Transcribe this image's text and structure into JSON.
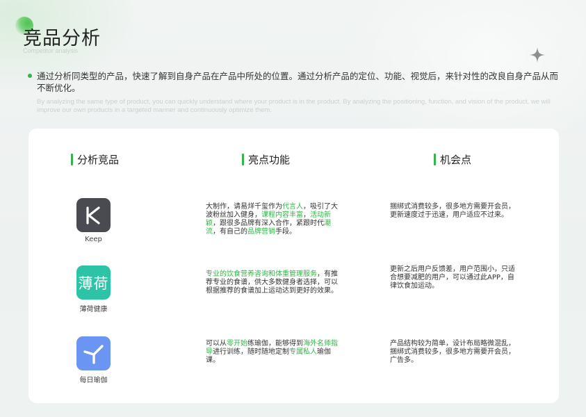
{
  "page": {
    "title": "竞品分析",
    "subtitle": "Competitor analysis"
  },
  "intro": {
    "cn": "通过分析同类型的产品，快速了解到自身产品在产品中所处的位置。通过分析产品的定位、功能、视觉后，来针对性的改良自身产品从而不断优化。",
    "en": "By analyzing the same type of product, you can quickly understand where your product is in the product. By analyzing the positioning, function, and vision of the product, we will improve our own products in a targeted manner and continuously optimize them."
  },
  "columns": [
    "分析竞品",
    "亮点功能",
    "机会点"
  ],
  "colors": {
    "accent": "#34b44a",
    "keep_icon": "#4a4a52",
    "boohee_icon": "#2dc3a6",
    "yoga_icon": "#6b95f3"
  },
  "rows": [
    {
      "app": {
        "name": "Keep",
        "icon": "keep-logo-icon"
      },
      "highlight": [
        {
          "t": "大制作，请易烊千玺作为"
        },
        {
          "t": "代言人",
          "hl": true
        },
        {
          "t": "，吸引了大波粉丝加入健身，"
        },
        {
          "t": "课程内容丰富",
          "hl": true
        },
        {
          "t": "，"
        },
        {
          "t": "活动新颖",
          "hl": true
        },
        {
          "t": "，跟很多品牌有深入合作，紧跟时代"
        },
        {
          "t": "潮流",
          "hl": true
        },
        {
          "t": "，有自己的"
        },
        {
          "t": "品牌营销",
          "hl": true
        },
        {
          "t": "手段。"
        }
      ],
      "opportunity": "捆绑式消费较多，很多地方需要开会员，更新速度过于迅速，用户适应不过来。"
    },
    {
      "app": {
        "name": "薄荷健康",
        "icon_text": "薄荷",
        "icon": "boohee-logo-icon"
      },
      "highlight": [
        {
          "t": "专业的饮食营养咨询和体重管理服务",
          "hl": true
        },
        {
          "t": "，有推荐专业的食谱，供大多数健身者选择，可以根据推荐的食谱加上运动达到更好的效果。"
        }
      ],
      "opportunity": "更新之后用户反馈差，用户范围小，只适合想要减肥的用户，可以通过此APP，自律饮食加运动。"
    },
    {
      "app": {
        "name": "每日瑜伽",
        "icon": "yoga-logo-icon"
      },
      "highlight": [
        {
          "t": "可以从"
        },
        {
          "t": "零开始",
          "hl": true
        },
        {
          "t": "练瑜伽，能够得到"
        },
        {
          "t": "海外名师指导",
          "hl": true
        },
        {
          "t": "进行训练，随时随地定制"
        },
        {
          "t": "专属私人",
          "hl": true
        },
        {
          "t": "瑜伽课。"
        }
      ],
      "opportunity": "产品结构较为简单，设计布局略微混乱，捆绑式消费较多，很多地方需要开会员，广告多。"
    }
  ]
}
